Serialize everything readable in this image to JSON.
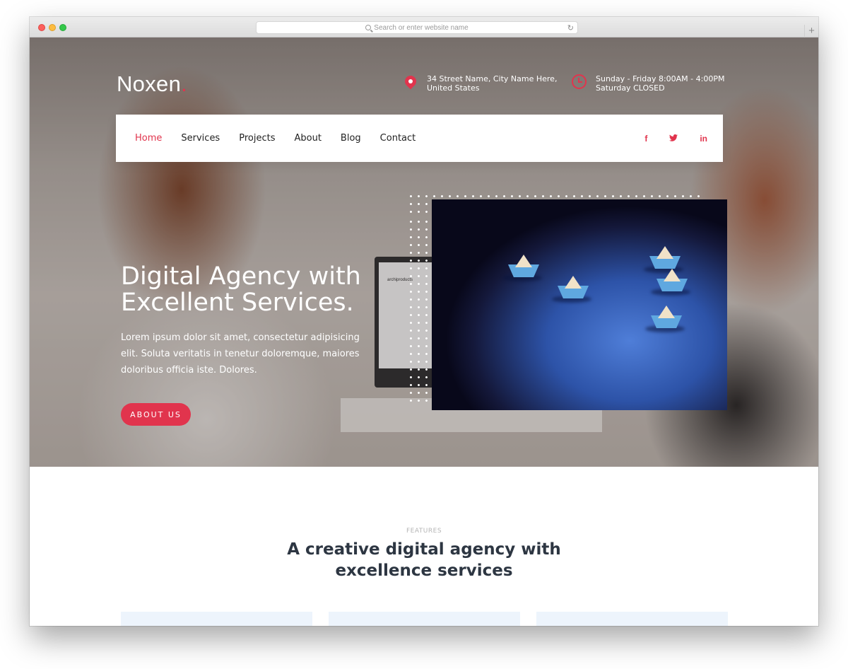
{
  "browser": {
    "url_placeholder": "Search or enter website name",
    "reload_icon": "reload-icon",
    "new_tab_label": "+"
  },
  "site": {
    "logo_text": "Noxen",
    "logo_dot": ".",
    "brand_color": "#e1344d",
    "address_line1": "34 Street Name, City Name Here,",
    "address_line2": "United States",
    "hours_line1": "Sunday - Friday 8:00AM - 4:00PM",
    "hours_line2": "Saturday CLOSED"
  },
  "nav": {
    "items": [
      "Home",
      "Services",
      "Projects",
      "About",
      "Blog",
      "Contact"
    ],
    "active": "Home",
    "social": [
      "f",
      "t",
      "in"
    ],
    "social_icons": [
      "facebook-icon",
      "twitter-icon",
      "linkedin-icon"
    ]
  },
  "hero": {
    "headline_line1": "Digital Agency with",
    "headline_line2": "Excellent Services.",
    "lede": "Lorem ipsum dolor sit amet, consectetur adipisicing elit. Soluta veritatis in tenetur doloremque, maiores doloribus officia iste. Dolores.",
    "button_label": "ABOUT US",
    "laptop_screen_text": "archiproducts"
  },
  "features": {
    "label": "FEATURES",
    "title": "A creative digital agency with excellence services"
  }
}
